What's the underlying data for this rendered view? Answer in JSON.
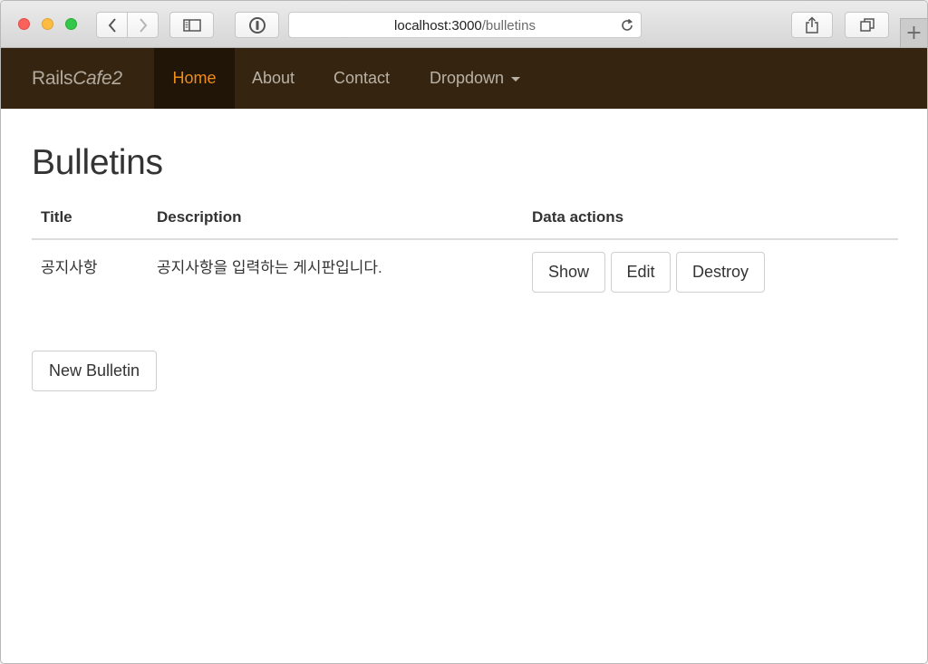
{
  "browser": {
    "url_host": "localhost:3000",
    "url_path": "/bulletins",
    "new_tab_label": "+"
  },
  "navbar": {
    "brand_main": "Rails",
    "brand_italic": "Cafe2",
    "items": [
      {
        "label": "Home",
        "active": true
      },
      {
        "label": "About"
      },
      {
        "label": "Contact"
      },
      {
        "label": "Dropdown"
      }
    ],
    "accent_color": "#f08c1a",
    "background_color": "#342410"
  },
  "page": {
    "title": "Bulletins",
    "table": {
      "headers": [
        "Title",
        "Description",
        "Data actions"
      ],
      "rows": [
        {
          "title": "공지사항",
          "description": "공지사항을 입력하는 게시판입니다.",
          "actions": [
            "Show",
            "Edit",
            "Destroy"
          ]
        }
      ]
    },
    "new_button_label": "New Bulletin"
  }
}
